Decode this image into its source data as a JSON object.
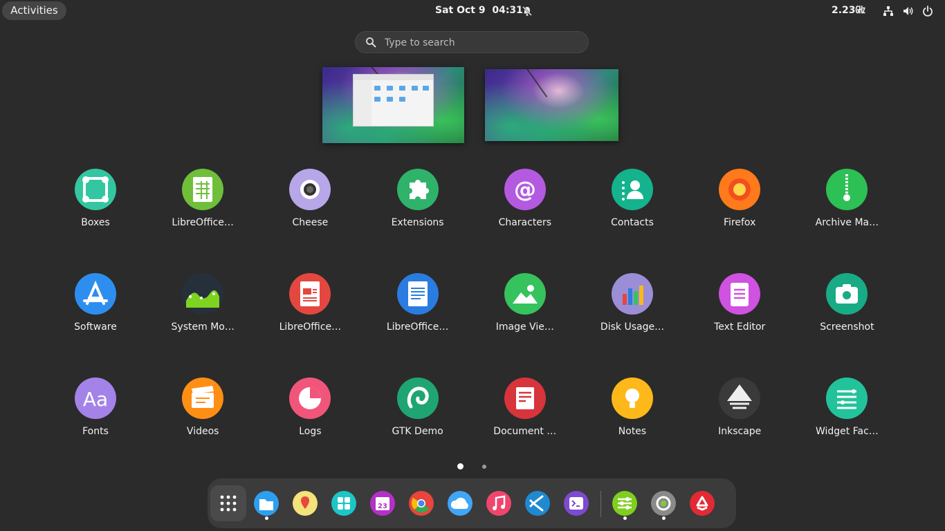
{
  "topbar": {
    "activities": "Activities",
    "clock": "Sat Oct 9  04:31",
    "cpu": "2.23㎓"
  },
  "search": {
    "placeholder": "Type to search"
  },
  "apps": [
    {
      "label": "Boxes",
      "icon": "boxes-icon",
      "color": "#33c6a0"
    },
    {
      "label": "LibreOffice…",
      "icon": "libreoffice-calc-icon",
      "color": "#6fbf3a"
    },
    {
      "label": "Cheese",
      "icon": "cheese-icon",
      "color": "#b7a6e8"
    },
    {
      "label": "Extensions",
      "icon": "extensions-icon",
      "color": "#2fb36a"
    },
    {
      "label": "Characters",
      "icon": "characters-icon",
      "color": "#b45ae0"
    },
    {
      "label": "Contacts",
      "icon": "contacts-icon",
      "color": "#14b38d"
    },
    {
      "label": "Firefox",
      "icon": "firefox-icon",
      "color": "#ff7a1a"
    },
    {
      "label": "Archive Ma…",
      "icon": "archive-manager-icon",
      "color": "#2cc055"
    },
    {
      "label": "Software",
      "icon": "software-icon",
      "color": "#2d8ef0"
    },
    {
      "label": "System Mo…",
      "icon": "system-monitor-icon",
      "color": "#26303a"
    },
    {
      "label": "LibreOffice…",
      "icon": "libreoffice-impress-icon",
      "color": "#e4473f"
    },
    {
      "label": "LibreOffice…",
      "icon": "libreoffice-writer-icon",
      "color": "#2b7ce0"
    },
    {
      "label": "Image Vie…",
      "icon": "image-viewer-icon",
      "color": "#36c25c"
    },
    {
      "label": "Disk Usage…",
      "icon": "disk-usage-icon",
      "color": "#9b8ed6"
    },
    {
      "label": "Text Editor",
      "icon": "text-editor-icon",
      "color": "#cf52e0"
    },
    {
      "label": "Screenshot",
      "icon": "screenshot-icon",
      "color": "#19ab86"
    },
    {
      "label": "Fonts",
      "icon": "fonts-icon",
      "color": "#a383e8"
    },
    {
      "label": "Videos",
      "icon": "videos-icon",
      "color": "#ff8f14"
    },
    {
      "label": "Logs",
      "icon": "logs-icon",
      "color": "#f2557a"
    },
    {
      "label": "GTK Demo",
      "icon": "gtk-demo-icon",
      "color": "#1fa572"
    },
    {
      "label": "Document …",
      "icon": "document-scanner-icon",
      "color": "#d7343c"
    },
    {
      "label": "Notes",
      "icon": "notes-icon",
      "color": "#ffb81a"
    },
    {
      "label": "Inkscape",
      "icon": "inkscape-icon",
      "color": "#3a3a3a"
    },
    {
      "label": "Widget Fac…",
      "icon": "widget-factory-icon",
      "color": "#22c39a"
    }
  ],
  "pages": {
    "current": 1,
    "total": 2
  },
  "dock": [
    {
      "icon": "show-apps-icon",
      "running": false
    },
    {
      "icon": "files-icon",
      "color": "#2d9ff0",
      "running": true
    },
    {
      "icon": "maps-icon",
      "color": "#f4e27a",
      "running": false
    },
    {
      "icon": "calculator-icon",
      "color": "#1dc6c6",
      "running": false
    },
    {
      "icon": "calendar-icon",
      "color": "#b431c8",
      "running": false
    },
    {
      "icon": "chrome-icon",
      "color": "#e8453c",
      "running": false
    },
    {
      "icon": "weather-icon",
      "color": "#42a5f5",
      "running": false
    },
    {
      "icon": "music-icon",
      "color": "#f0466e",
      "running": false
    },
    {
      "icon": "vscode-icon",
      "color": "#1f8ad2",
      "running": false
    },
    {
      "icon": "terminal-icon",
      "color": "#7d4ad0",
      "running": false
    },
    {
      "icon": "tweaks-icon",
      "color": "#7fcf1e",
      "running": true
    },
    {
      "icon": "screen-recorder-icon",
      "color": "#8a8a8a",
      "running": true
    },
    {
      "icon": "trash-icon",
      "color": "#e22a35",
      "running": false
    }
  ],
  "calendar_day": "23"
}
